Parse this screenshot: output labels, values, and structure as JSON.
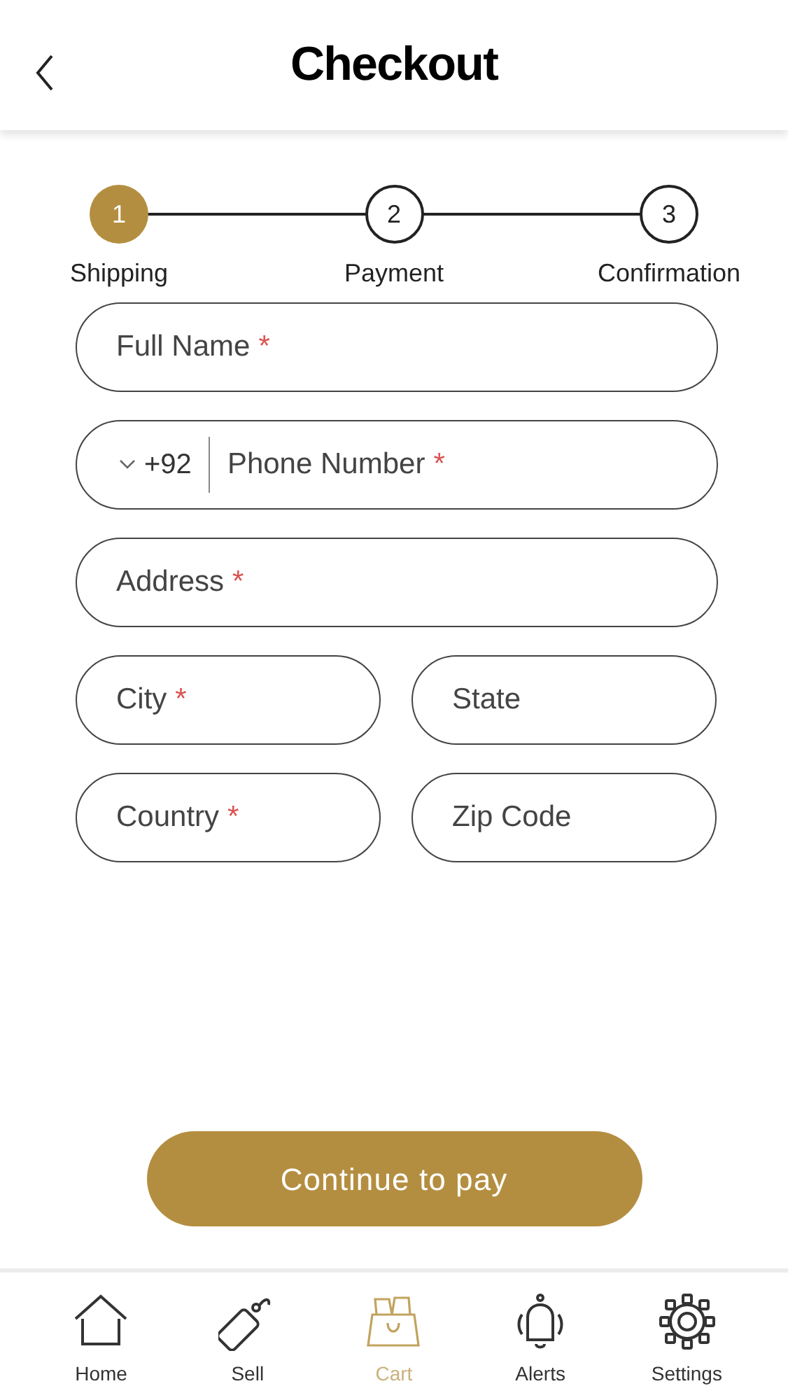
{
  "header": {
    "title": "Checkout"
  },
  "steps": [
    {
      "number": "1",
      "label": "Shipping",
      "selected": true
    },
    {
      "number": "2",
      "label": "Payment",
      "selected": false
    },
    {
      "number": "3",
      "label": "Confirmation",
      "selected": false
    }
  ],
  "fields": [
    {
      "kind": "text",
      "placeholder": "Full Name",
      "required": true
    },
    {
      "kind": "phone",
      "country_code": "+92",
      "placeholder": "Phone Number",
      "required": true
    },
    {
      "kind": "text",
      "placeholder": "Address",
      "required": true
    },
    {
      "kind": "text",
      "placeholder": "City",
      "required": true,
      "half": true
    },
    {
      "kind": "text",
      "placeholder": "State",
      "required": false,
      "half": true
    },
    {
      "kind": "text",
      "placeholder": "Country",
      "required": true,
      "half": true
    },
    {
      "kind": "text",
      "placeholder": "Zip Code",
      "required": false,
      "half": true
    }
  ],
  "required_mark": "*",
  "submit_button": "Continue to pay",
  "nav": [
    {
      "kind": "home",
      "label": "Home",
      "selected": false
    },
    {
      "kind": "sell",
      "label": "Sell",
      "selected": false
    },
    {
      "kind": "cart",
      "label": "Cart",
      "selected": true
    },
    {
      "kind": "alerts",
      "label": "Alerts",
      "selected": false
    },
    {
      "kind": "settings",
      "label": "Settings",
      "selected": false
    }
  ]
}
